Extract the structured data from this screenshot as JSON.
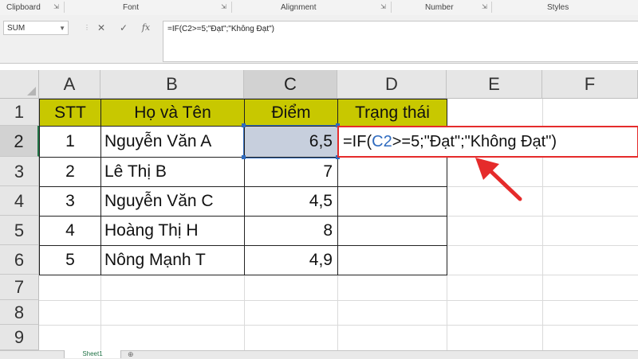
{
  "ribbon": {
    "clipboard": "Clipboard",
    "font": "Font",
    "alignment": "Alignment",
    "number": "Number",
    "styles": "Styles"
  },
  "formula_bar": {
    "name_box": "SUM",
    "cancel_icon": "close-icon",
    "enter_icon": "check-icon",
    "insert_function": "fx",
    "formula": "=IF(C2>=5;\"Đạt\";\"Không Đạt\")"
  },
  "columns": [
    "A",
    "B",
    "C",
    "D",
    "E",
    "F"
  ],
  "rows": [
    "1",
    "2",
    "3",
    "4",
    "5",
    "6",
    "7",
    "8",
    "9"
  ],
  "table": {
    "headers": [
      "STT",
      "Họ và Tên",
      "Điểm",
      "Trạng thái"
    ],
    "data": [
      [
        "1",
        "Nguyễn Văn A",
        "6,5"
      ],
      [
        "2",
        "Lê Thị B",
        "7"
      ],
      [
        "3",
        "Nguyễn Văn C",
        "4,5"
      ],
      [
        "4",
        "Hoàng Thị H",
        "8"
      ],
      [
        "5",
        "Nông Mạnh T",
        "4,9"
      ]
    ]
  },
  "edit_cell": {
    "prefix": "=IF(",
    "ref": "C2",
    "suffix": ">=5;\"Đạt\";\"Không Đạt\")"
  },
  "sheet_tab": "Sheet1",
  "colors": {
    "header_fill": "#c8c800",
    "selected_cell_fill": "#c7cfdd",
    "annotation": "#e52b2b",
    "ref_blue": "#2f6bbf",
    "excel_green": "#217346"
  }
}
